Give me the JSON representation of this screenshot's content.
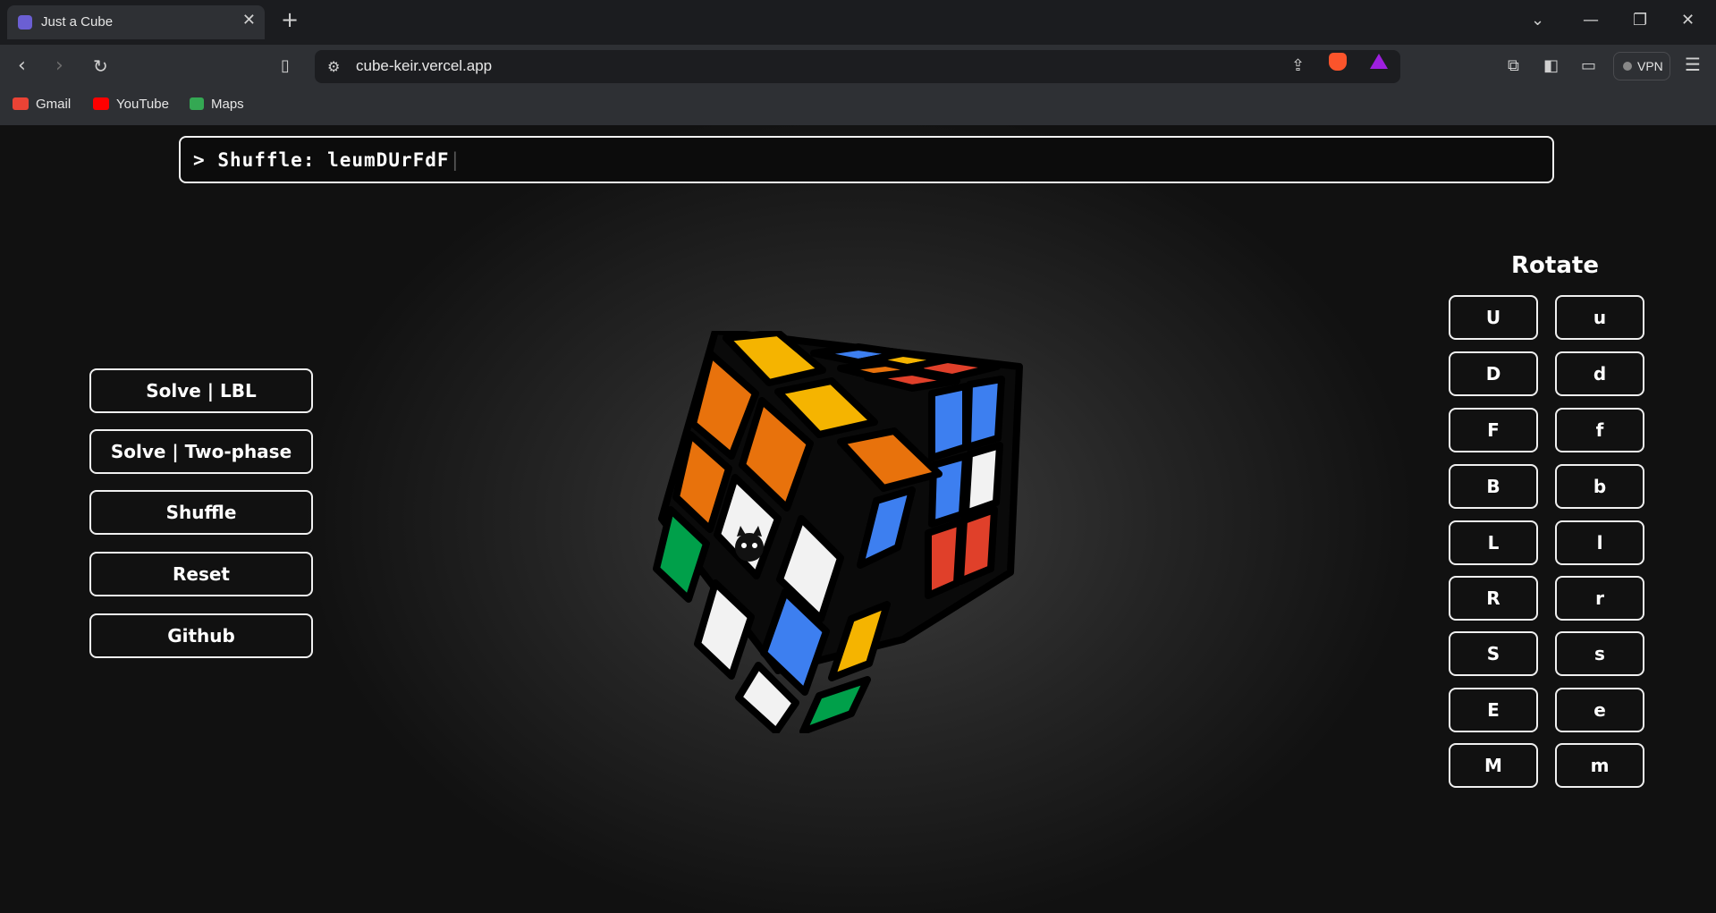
{
  "browser": {
    "tab_title": "Just a Cube",
    "url": "cube-keir.vercel.app",
    "vpn_label": "VPN",
    "bookmarks": [
      {
        "label": "Gmail",
        "icon": "gmail-icon",
        "color": "#ea4335"
      },
      {
        "label": "YouTube",
        "icon": "youtube-icon",
        "color": "#ff0000"
      },
      {
        "label": "Maps",
        "icon": "maps-icon",
        "color": "#34a853"
      }
    ]
  },
  "terminal": {
    "prompt": ">",
    "text": "Shuffle: leumDUrFdF",
    "caret": "|"
  },
  "left_panel": {
    "buttons": [
      "Solve | LBL",
      "Solve | Two-phase",
      "Shuffle",
      "Reset",
      "Github"
    ]
  },
  "rotate_panel": {
    "title": "Rotate",
    "rows": [
      [
        "U",
        "u"
      ],
      [
        "D",
        "d"
      ],
      [
        "F",
        "f"
      ],
      [
        "B",
        "b"
      ],
      [
        "L",
        "l"
      ],
      [
        "R",
        "r"
      ],
      [
        "S",
        "s"
      ],
      [
        "E",
        "e"
      ],
      [
        "M",
        "m"
      ]
    ]
  },
  "cube_colors": {
    "orange": "#e8720c",
    "yellow": "#f5b400",
    "white": "#f2f2f2",
    "blue": "#3d7ff0",
    "green": "#00a04a",
    "red": "#e0402a"
  }
}
